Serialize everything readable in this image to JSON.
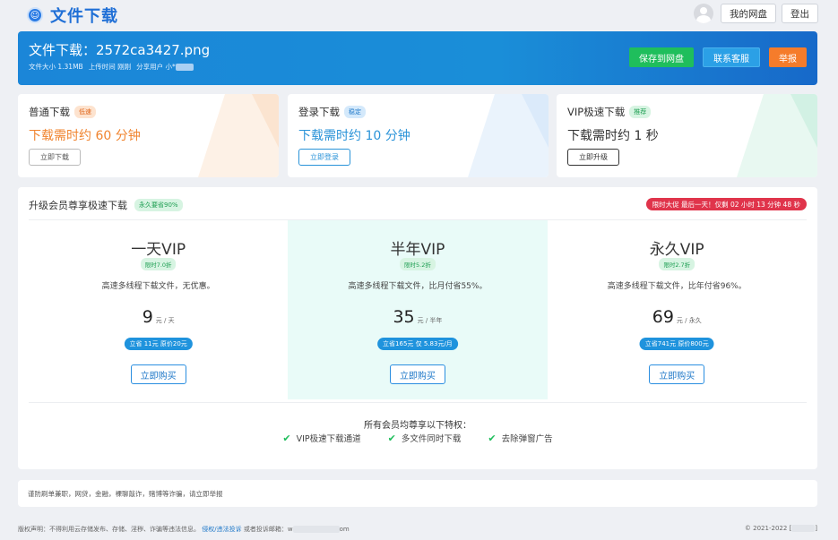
{
  "header": {
    "logo_glyph": "☺",
    "title": "文件下载",
    "my_disk": "我的网盘",
    "logout": "登出"
  },
  "banner": {
    "title": "文件下载：2572ca3427.png",
    "size": "文件大小 1.31MB",
    "upload_time": "上传时间 刚刚",
    "sharer": "分享用户 小*",
    "save_btn": "保存到网盘",
    "service_btn": "联系客服",
    "report_btn": "举报"
  },
  "speed_cards": [
    {
      "title": "普通下载",
      "tag": "低速",
      "time": "下载需时约 60 分钟",
      "button": "立即下载",
      "color": "#f0842f"
    },
    {
      "title": "登录下载",
      "tag": "稳定",
      "time": "下载需时约 10 分钟",
      "button": "立即登录",
      "color": "#2a93d8"
    },
    {
      "title": "VIP极速下载",
      "tag": "推荐",
      "time": "下载需时约 1 秒",
      "button": "立即升级",
      "color": "#333333"
    }
  ],
  "vip": {
    "title": "升级会员尊享极速下载",
    "title_tag": "永久要省90%",
    "countdown": "限时大促 最后一天！仅剩 02 小时 13 分钟 48 秒",
    "plans": [
      {
        "name": "一天VIP",
        "discount": "限时7.0折",
        "desc": "高速多线程下载文件，无优惠。",
        "price": "9",
        "unit": "元 / 天",
        "save": "立省 11元 原价20元",
        "buy": "立即购买"
      },
      {
        "name": "半年VIP",
        "discount": "限时5.2折",
        "desc": "高速多线程下载文件，比月付省55%。",
        "price": "35",
        "unit": "元 / 半年",
        "save": "立省165元 仅 5.83元/月",
        "buy": "立即购买"
      },
      {
        "name": "永久VIP",
        "discount": "限时2.7折",
        "desc": "高速多线程下载文件，比年付省96%。",
        "price": "69",
        "unit": "元 / 永久",
        "save": "立省741元 原价800元",
        "buy": "立即购买"
      }
    ],
    "perks_title": "所有会员均尊享以下特权：",
    "perks": [
      "VIP极速下载通道",
      "多文件同时下载",
      "去除弹窗广告"
    ]
  },
  "notice": "谨防刷单兼职，网贷，金融，裸聊敲诈，赌博等诈骗，请立即举报",
  "footer": {
    "left_text": "版权声明：不得利用云存储发布、存储、淫秽、诈骗等违法信息。",
    "link": "侵权/违法投诉",
    "email_label": "或者投诉邮箱：w",
    "email_end": "om",
    "copyright": "© 2021-2022 [",
    "copyright_end": "]"
  }
}
